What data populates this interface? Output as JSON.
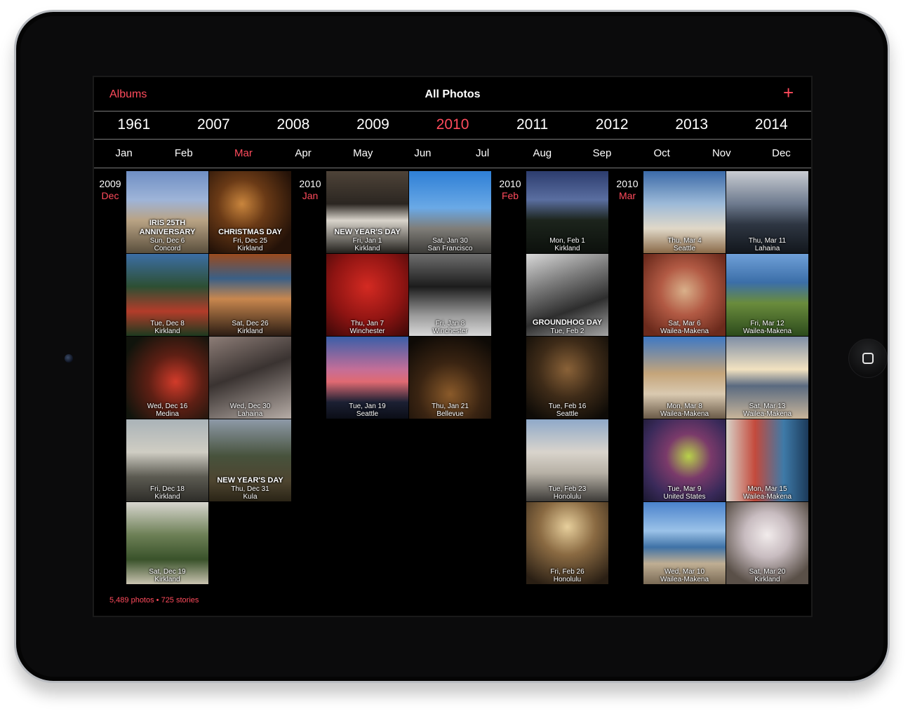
{
  "nav": {
    "back_label": "Albums",
    "title": "All Photos",
    "add_glyph": "+"
  },
  "years": [
    "1961",
    "2007",
    "2008",
    "2009",
    "2010",
    "2011",
    "2012",
    "2013",
    "2014"
  ],
  "selected_year": "2010",
  "months": [
    "Jan",
    "Feb",
    "Mar",
    "Apr",
    "May",
    "Jun",
    "Jul",
    "Aug",
    "Sep",
    "Oct",
    "Nov",
    "Dec"
  ],
  "selected_month": "Mar",
  "groups": [
    {
      "year": "2009",
      "month": "Dec",
      "photos": [
        {
          "event": "IRIS 25TH ANNIVERSARY",
          "date": "Sun, Dec 6",
          "place": "Concord",
          "bg": "linear-gradient(180deg,#6f8fc4 0%,#9eb4d8 35%,#b9a384 60%,#5a4f3d 100%)"
        },
        {
          "event": "CHRISTMAS DAY",
          "date": "Fri, Dec 25",
          "place": "Kirkland",
          "bg": "radial-gradient(circle at 40% 40%,#c9853d 0%,#6a3a16 35%,#241208 80%)"
        },
        {
          "event": "",
          "date": "Tue, Dec 8",
          "place": "Kirkland",
          "bg": "linear-gradient(180deg,#3c6ea5 0%,#2d4f33 40%,#b33c2a 70%,#1d3a1f 100%)"
        },
        {
          "event": "",
          "date": "Sat, Dec 26",
          "place": "Kirkland",
          "bg": "linear-gradient(180deg,#9a4a1e 0%,#3a5f86 30%,#c8874e 55%,#2b1c13 100%)"
        },
        {
          "event": "",
          "date": "Wed, Dec 16",
          "place": "Medina",
          "bg": "radial-gradient(circle at 60% 55%,#d23b2a 0%,#5e1f14 40%,#10140c 85%)"
        },
        {
          "event": "",
          "date": "Wed, Dec 30",
          "place": "Lahaina",
          "bg": "linear-gradient(160deg,#8d7d77 0%,#3a3331 45%,#b6aca6 100%)"
        },
        {
          "event": "",
          "date": "Fri, Dec 18",
          "place": "Kirkland",
          "bg": "linear-gradient(180deg,#aab3b8 0%,#cfcdc3 40%,#5c5b52 70%,#2e2d29 100%)"
        },
        {
          "event": "NEW YEAR'S DAY",
          "date": "Thu, Dec 31",
          "place": "Kula",
          "bg": "linear-gradient(180deg,#8e9aa8 0%,#47523c 45%,#4e4530 75%,#2a2416 100%)"
        },
        {
          "event": "",
          "date": "Sat, Dec 19",
          "place": "Kirkland",
          "bg": "linear-gradient(180deg,#d8d6cf 0%,#6d8056 40%,#39522a 70%,#c9c3b0 100%)"
        }
      ]
    },
    {
      "year": "2010",
      "month": "Jan",
      "photos": [
        {
          "event": "NEW YEAR'S DAY",
          "date": "Fri, Jan 1",
          "place": "Kirkland",
          "bg": "linear-gradient(180deg,#4e4338 0%,#2b2621 40%,#d9d4cb 60%,#22201c 100%)"
        },
        {
          "event": "",
          "date": "Sat, Jan 30",
          "place": "San Francisco",
          "bg": "linear-gradient(180deg,#2e7fd6 0%,#6aa9e6 45%,#7f7d78 70%,#3c3b38 100%)"
        },
        {
          "event": "",
          "date": "Thu, Jan 7",
          "place": "Winchester",
          "bg": "radial-gradient(circle at 50% 40%,#d42a22 0%,#8e1412 55%,#3b0808 100%)"
        },
        {
          "event": "",
          "date": "Fri, Jan 8",
          "place": "Winchester",
          "bg": "linear-gradient(180deg,#6e6e6e 0%,#1c1c1c 40%,#9a9a9a 75%,#d8d8d8 100%)"
        },
        {
          "event": "",
          "date": "Tue, Jan 19",
          "place": "Seattle",
          "bg": "linear-gradient(180deg,#3a5ea8 0%,#c46e98 40%,#e06a72 55%,#1b2033 80%,#0b0d16 100%)"
        },
        {
          "event": "",
          "date": "Thu, Jan 21",
          "place": "Bellevue",
          "bg": "radial-gradient(circle at 50% 70%,#8a5a2a 0%,#3a2412 45%,#0e0a06 90%)"
        }
      ]
    },
    {
      "year": "2010",
      "month": "Feb",
      "photos": [
        {
          "event": "",
          "date": "Mon, Feb 1",
          "place": "Kirkland",
          "bg": "linear-gradient(180deg,#2c3c6e 0%,#5a6ea0 35%,#1c241c 60%,#0c100c 100%)"
        },
        {
          "event": "GROUNDHOG DAY",
          "date": "Tue, Feb 2",
          "place": "",
          "bg": "linear-gradient(160deg,#d9d9d9 0%,#7a7a7a 35%,#2e2e2e 65%,#a5a5a5 100%)"
        },
        {
          "event": "",
          "date": "Tue, Feb 16",
          "place": "Seattle",
          "bg": "radial-gradient(circle at 50% 40%,#8a6238 0%,#3e2b18 45%,#0e0b07 90%)"
        },
        {
          "event": "",
          "date": "Tue, Feb 23",
          "place": "Honolulu",
          "bg": "linear-gradient(180deg,#8fa9c9 0%,#d9d4cc 40%,#b7b1a6 65%,#3d3b38 100%)"
        },
        {
          "event": "",
          "date": "Fri, Feb 26",
          "place": "Honolulu",
          "bg": "radial-gradient(circle at 50% 30%,#e7cf9c 0%,#8a6a42 40%,#2a1f14 90%)"
        }
      ]
    },
    {
      "year": "2010",
      "month": "Mar",
      "photos": [
        {
          "event": "",
          "date": "Thu, Mar 4",
          "place": "Seattle",
          "bg": "linear-gradient(180deg,#3b6aa8 0%,#9dbad8 40%,#e0d8c8 70%,#8a6a48 100%)"
        },
        {
          "event": "",
          "date": "Thu, Mar 11",
          "place": "Lahaina",
          "bg": "linear-gradient(180deg,#c9ccd2 0%,#6d7a8e 40%,#2e3642 65%,#12161c 100%)"
        },
        {
          "event": "",
          "date": "Sat, Mar 6",
          "place": "Wailea-Makena",
          "bg": "radial-gradient(circle at 50% 45%,#d9b08a 0%,#b25a44 40%,#6b2a1c 85%)"
        },
        {
          "event": "",
          "date": "Fri, Mar 12",
          "place": "Wailea-Makena",
          "bg": "linear-gradient(180deg,#6fa0d8 0%,#3b6ea8 35%,#6a8c3c 60%,#2c4a1c 100%)"
        },
        {
          "event": "",
          "date": "Mon, Mar 8",
          "place": "Wailea-Makena",
          "bg": "linear-gradient(180deg,#3e78c4 0%,#c5a57a 45%,#d9c9b0 70%,#6a5a48 100%)"
        },
        {
          "event": "",
          "date": "Sat, Mar 13",
          "place": "Wailea-Makena",
          "bg": "linear-gradient(180deg,#7e8ea6 0%,#f2e2c0 40%,#5a6a80 60%,#c8b59a 100%)"
        },
        {
          "event": "",
          "date": "Tue, Mar 9",
          "place": "United States",
          "bg": "radial-gradient(circle at 55% 45%,#b8d24a 0%,#7a3a6a 35%,#3a2a5a 70%,#1a1830 100%)"
        },
        {
          "event": "",
          "date": "Mon, Mar 15",
          "place": "Wailea-Makena",
          "bg": "linear-gradient(90deg,#d8d2c8 0%,#c44a3c 35%,#3e7aa8 70%,#1c3a5a 100%)"
        },
        {
          "event": "",
          "date": "Wed, Mar 10",
          "place": "Wailea-Makena",
          "bg": "linear-gradient(180deg,#4a82cc 0%,#9bc2e8 35%,#3f72a6 55%,#bfae93 75%,#7a6a55 100%)"
        },
        {
          "event": "",
          "date": "Sat, Mar 20",
          "place": "Kirkland",
          "bg": "radial-gradient(circle at 50% 40%,#f2ecec 0%,#c8bcc0 35%,#5a5048 80%)"
        }
      ]
    }
  ],
  "footer": {
    "stats": "5,489 photos • 725 stories"
  }
}
